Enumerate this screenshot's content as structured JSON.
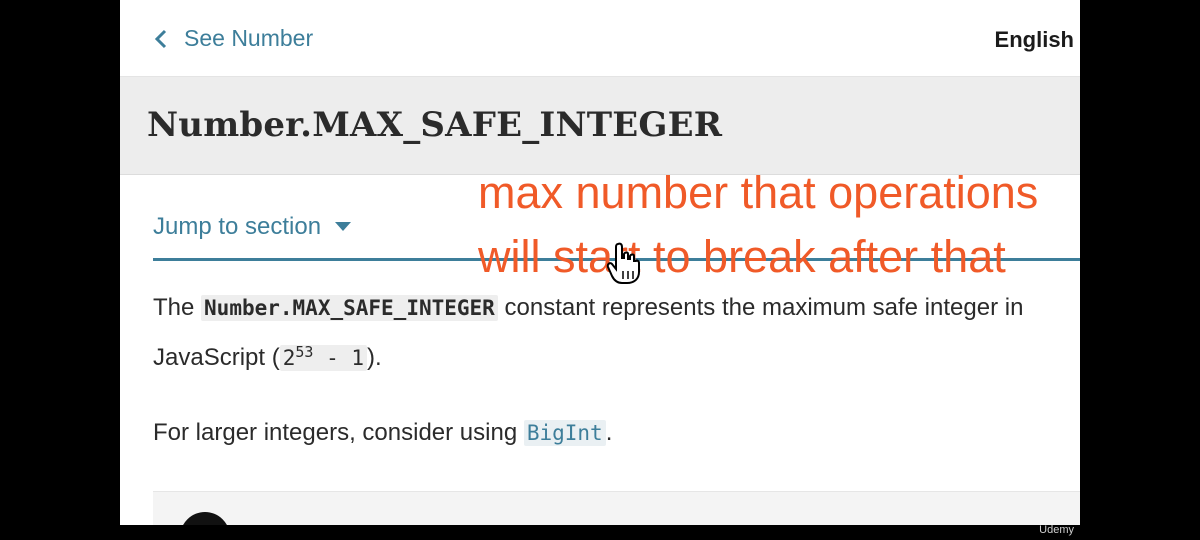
{
  "nav": {
    "back_label": "See Number",
    "language": "English"
  },
  "title": "Number.MAX_SAFE_INTEGER",
  "jump": {
    "label": "Jump to section"
  },
  "para1": {
    "prefix": "The ",
    "code": "Number.MAX_SAFE_INTEGER",
    "middle": " constant represents the maximum safe integer in JavaScript (",
    "expr_base": "2",
    "expr_exp": "53",
    "expr_rest": " - 1",
    "suffix": ")."
  },
  "para2": {
    "prefix": "For larger integers, consider using ",
    "code": "BigInt",
    "suffix": "."
  },
  "annotation": {
    "line1": "max number that operations",
    "line2": "will start to break after that"
  },
  "colors": {
    "link": "#3d7e9a",
    "annotation": "#f05a28",
    "title_bar": "#ededed"
  },
  "watermark": "Udemy"
}
